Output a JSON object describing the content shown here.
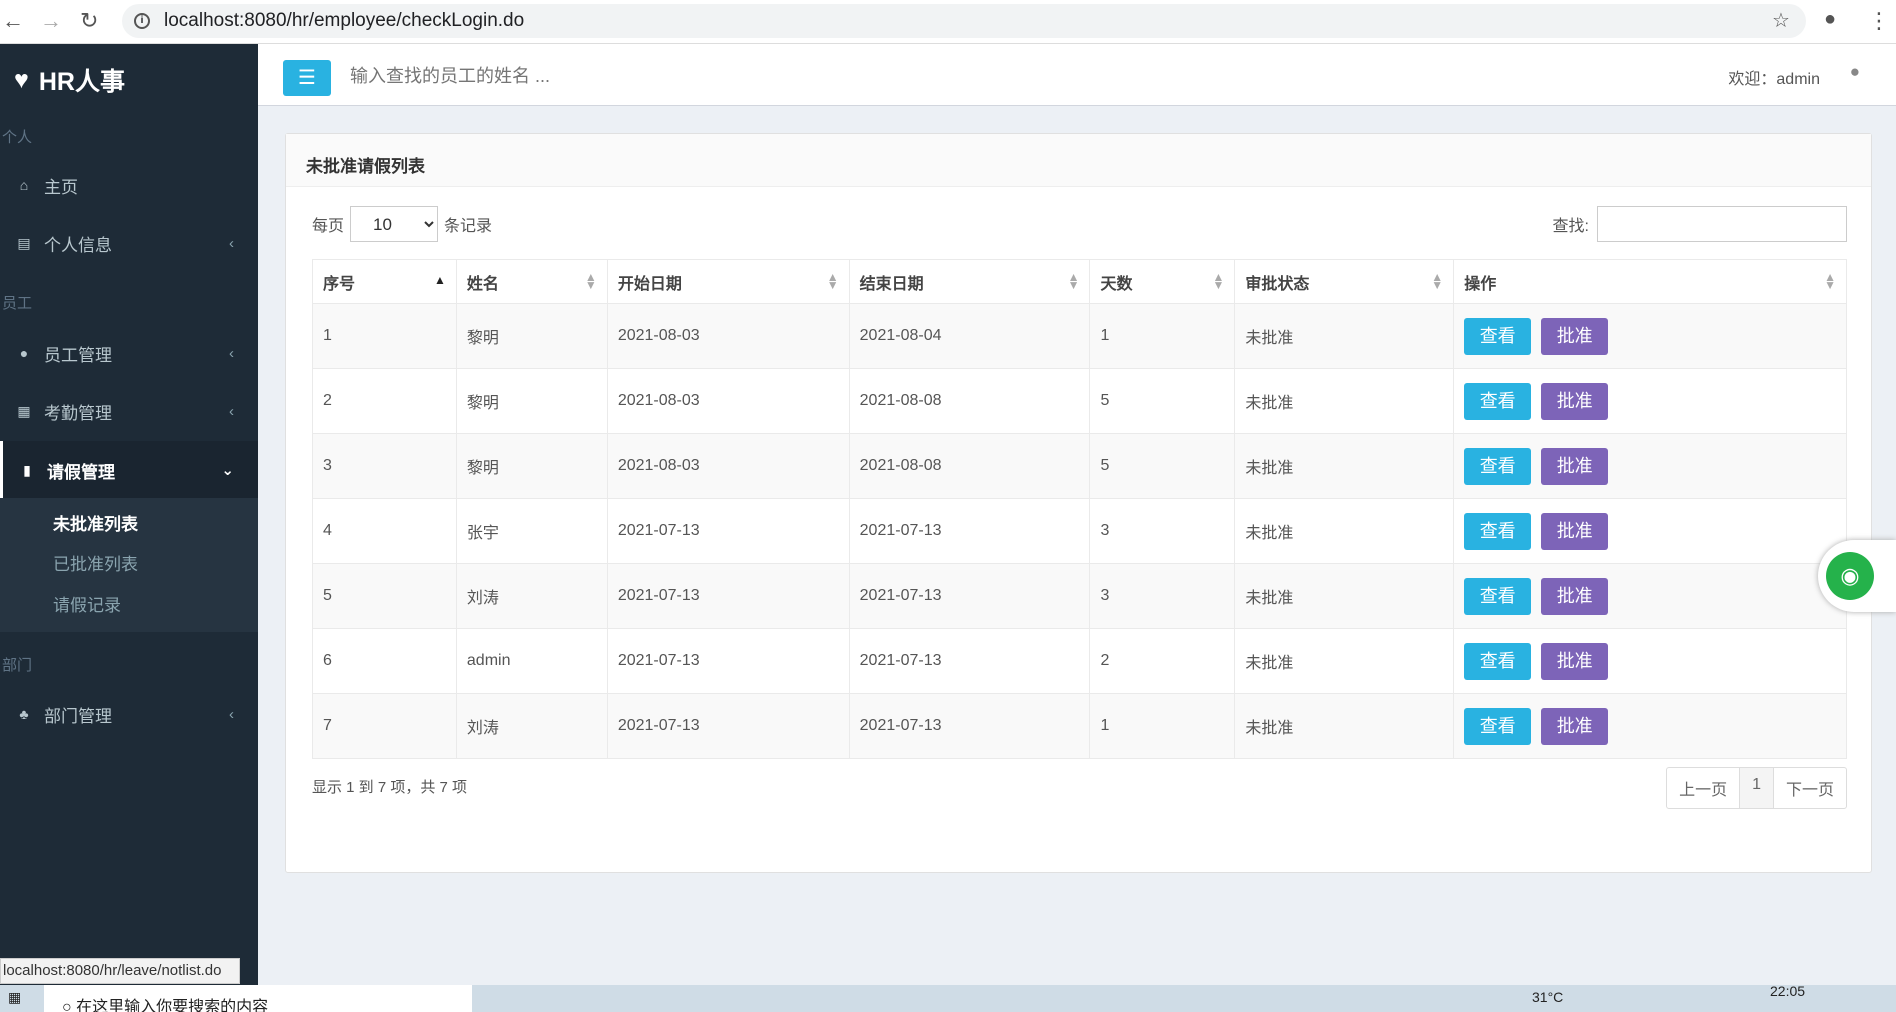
{
  "browser": {
    "url": "localhost:8080/hr/employee/checkLogin.do",
    "status_url": "localhost:8080/hr/leave/notlist.do"
  },
  "sidebar": {
    "logo": "HR人事",
    "sections": [
      "个人",
      "员工",
      "部门"
    ],
    "items": [
      {
        "label": "主页",
        "icon": "home-icon"
      },
      {
        "label": "个人信息",
        "icon": "id-card-icon"
      },
      {
        "label": "员工管理",
        "icon": "user-icon"
      },
      {
        "label": "考勤管理",
        "icon": "calendar-icon"
      },
      {
        "label": "请假管理",
        "icon": "bookmark-icon"
      },
      {
        "label": "部门管理",
        "icon": "sitemap-icon"
      }
    ],
    "submenu": [
      "未批准列表",
      "已批准列表",
      "请假记录"
    ]
  },
  "header": {
    "search_placeholder": "输入查找的员工的姓名 ...",
    "welcome": "欢迎：admin"
  },
  "panel": {
    "title": "未批准请假列表",
    "per_page_prefix": "每页",
    "per_page_value": "10",
    "per_page_suffix": "条记录",
    "find_label": "查找:",
    "columns": [
      "序号",
      "姓名",
      "开始日期",
      "结束日期",
      "天数",
      "审批状态",
      "操作"
    ],
    "rows": [
      [
        "1",
        "黎明",
        "2021-08-03",
        "2021-08-04",
        "1",
        "未批准"
      ],
      [
        "2",
        "黎明",
        "2021-08-03",
        "2021-08-08",
        "5",
        "未批准"
      ],
      [
        "3",
        "黎明",
        "2021-08-03",
        "2021-08-08",
        "5",
        "未批准"
      ],
      [
        "4",
        "张宇",
        "2021-07-13",
        "2021-07-13",
        "3",
        "未批准"
      ],
      [
        "5",
        "刘涛",
        "2021-07-13",
        "2021-07-13",
        "3",
        "未批准"
      ],
      [
        "6",
        "admin",
        "2021-07-13",
        "2021-07-13",
        "2",
        "未批准"
      ],
      [
        "7",
        "刘涛",
        "2021-07-13",
        "2021-07-13",
        "1",
        "未批准"
      ]
    ],
    "view_label": "查看",
    "approve_label": "批准",
    "info": "显示 1 到 7 项，共 7 项",
    "pager": {
      "prev": "上一页",
      "page": "1",
      "next": "下一页"
    }
  },
  "taskbar": {
    "search": "在这里输入你要搜索的内容",
    "temp": "31°C",
    "time": "22:05"
  }
}
